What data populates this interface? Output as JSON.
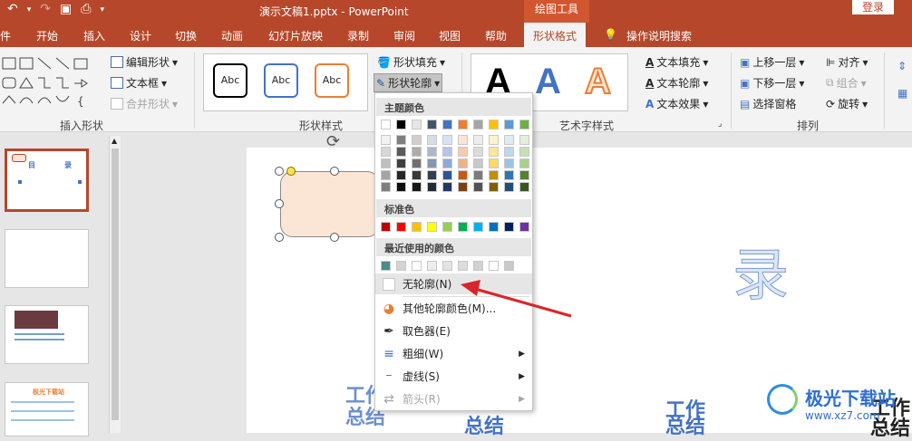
{
  "titlebar": {
    "doc_title": "演示文稿1.pptx  -  PowerPoint",
    "contextual_group": "绘图工具",
    "login": "登录"
  },
  "tabs": [
    "件",
    "开始",
    "插入",
    "设计",
    "切换",
    "动画",
    "幻灯片放映",
    "录制",
    "审阅",
    "视图",
    "帮助",
    "形状格式"
  ],
  "active_tab": "形状格式",
  "tell_me": "操作说明搜索",
  "ribbon": {
    "insert_shapes": {
      "label": "插入形状",
      "edit_shape": "编辑形状",
      "text_box": "文本框",
      "merge_shapes": "合并形状"
    },
    "shape_styles": {
      "label": "形状样式",
      "style_sample": "Abc",
      "fill": "形状填充",
      "outline": "形状轮廓"
    },
    "wordart": {
      "label": "艺术字样式",
      "letter": "A",
      "text_fill": "文本填充",
      "text_outline": "文本轮廓",
      "text_effect": "文本效果"
    },
    "arrange": {
      "label": "排列",
      "bring_forward": "上移一层",
      "send_backward": "下移一层",
      "selection_pane": "选择窗格",
      "align": "对齐",
      "group": "组合",
      "rotate": "旋转"
    }
  },
  "dropdown": {
    "theme_colors_title": "主题颜色",
    "theme_top": [
      "#ffffff",
      "#000000",
      "#e7e6e6",
      "#44546a",
      "#4472c4",
      "#ed7d31",
      "#a5a5a5",
      "#ffc000",
      "#5b9bd5",
      "#70ad47"
    ],
    "theme_shades": [
      [
        "#f2f2f2",
        "#7f7f7f",
        "#d0cece",
        "#d6dce4",
        "#d9e2f3",
        "#fbe5d5",
        "#ededed",
        "#fff2cc",
        "#deebf6",
        "#e2efd9"
      ],
      [
        "#d8d8d8",
        "#595959",
        "#aeabab",
        "#adb9ca",
        "#b4c6e7",
        "#f7cbac",
        "#dbdbdb",
        "#fee599",
        "#bdd7ee",
        "#c5e0b3"
      ],
      [
        "#bfbfbf",
        "#3f3f3f",
        "#757070",
        "#8496b0",
        "#8eaadb",
        "#f4b183",
        "#c9c9c9",
        "#ffd965",
        "#9cc3e5",
        "#a8d08d"
      ],
      [
        "#a5a5a5",
        "#262626",
        "#3a3838",
        "#323f4f",
        "#2f5496",
        "#c55a11",
        "#7b7b7b",
        "#bf9000",
        "#2e75b5",
        "#538135"
      ],
      [
        "#7f7f7f",
        "#0c0c0c",
        "#171616",
        "#222a35",
        "#1f3864",
        "#833c0b",
        "#525252",
        "#7f6000",
        "#1e4e79",
        "#375623"
      ]
    ],
    "standard_title": "标准色",
    "standard": [
      "#c00000",
      "#ff0000",
      "#ffc000",
      "#ffff00",
      "#92d050",
      "#00b050",
      "#00b0f0",
      "#0070c0",
      "#002060",
      "#7030a0"
    ],
    "recent_title": "最近使用的颜色",
    "recent": [
      "#4d8b8b",
      "#d4d4d4",
      "#ffffff",
      "#ececec",
      "#e3e3e3",
      "#dcdcdc",
      "#d2d2d2",
      "#ffffff",
      "#c8c8c8"
    ],
    "no_outline": "无轮廓(N)",
    "more_colors": "其他轮廓颜色(M)...",
    "eyedropper": "取色器(E)",
    "weight": "粗细(W)",
    "dashes": "虚线(S)",
    "arrows": "箭头(R)"
  },
  "slide": {
    "char_lu": "录",
    "work": "工作",
    "summary": "总结"
  },
  "thumbs": {
    "t1_mu": "目",
    "t1_lu": "录",
    "t4_title": "极光下载站"
  },
  "watermark": {
    "name": "极光下载站",
    "url": "www.xz7.com"
  },
  "colors": {
    "accent": "#b7472a",
    "arrow": "#d9262a"
  }
}
